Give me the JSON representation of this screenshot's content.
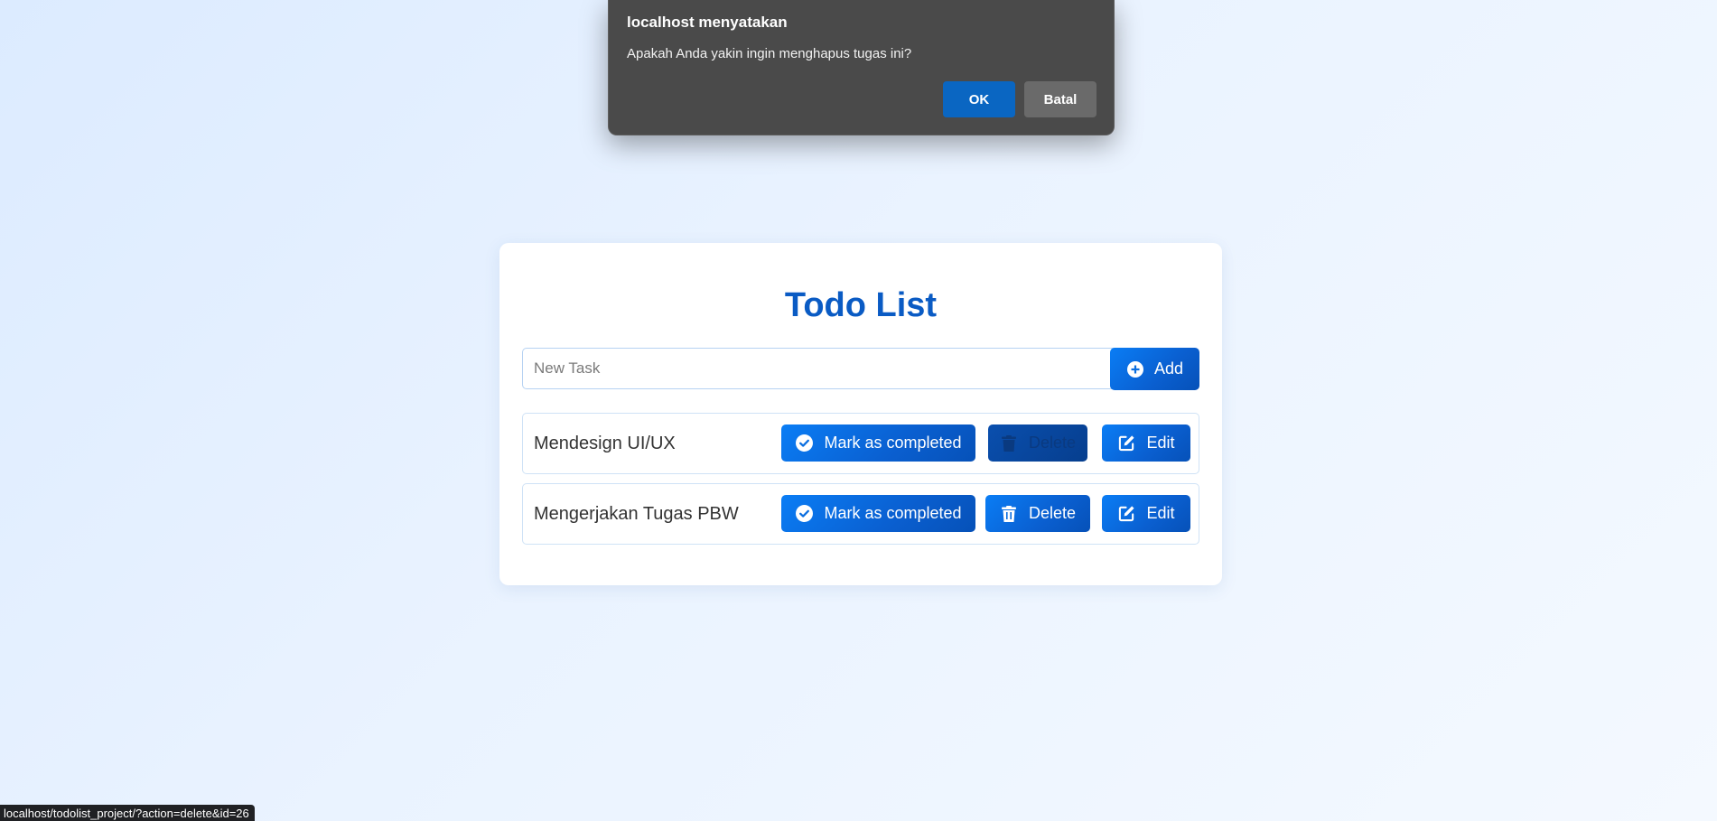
{
  "todo": {
    "title": "Todo List",
    "new_task_placeholder": "New Task",
    "new_task_value": "",
    "add_label": "Add",
    "tasks": [
      {
        "text": "Mendesign UI/UX",
        "mark_label": "Mark as completed",
        "delete_label": "Delete",
        "edit_label": "Edit"
      },
      {
        "text": "Mengerjakan Tugas PBW",
        "mark_label": "Mark as completed",
        "delete_label": "Delete",
        "edit_label": "Edit"
      }
    ]
  },
  "dialog": {
    "title": "localhost menyatakan",
    "message": "Apakah Anda yakin ingin menghapus tugas ini?",
    "ok_label": "OK",
    "cancel_label": "Batal"
  },
  "status_bar": {
    "url": "localhost/todolist_project/?action=delete&id=26"
  },
  "icons": {
    "add": "plus-circle-icon",
    "mark": "check-circle-icon",
    "delete": "trash-icon",
    "edit": "edit-icon"
  },
  "colors": {
    "accent": "#0a6ee0",
    "title": "#0a5bc4",
    "dialog_bg": "#4a4a4a",
    "ok_button": "#0a66c2",
    "cancel_button": "#6a6a6a"
  }
}
